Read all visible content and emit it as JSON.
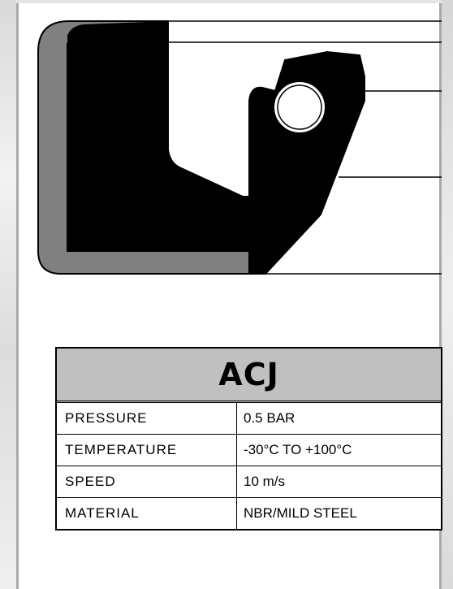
{
  "product": {
    "code": "ACJ"
  },
  "specs": [
    {
      "label": "PRESSURE",
      "value": "0.5 BAR"
    },
    {
      "label": "TEMPERATURE",
      "value": "-30°C  TO  +100°C"
    },
    {
      "label": "SPEED",
      "value": "10 m/s"
    },
    {
      "label": "MATERIAL",
      "value": "NBR/MILD STEEL"
    }
  ],
  "colors": {
    "seal_body": "#000000",
    "metal_case": "#808080",
    "table_header": "#c0c0c0",
    "panel_border": "#a9a9a9"
  }
}
